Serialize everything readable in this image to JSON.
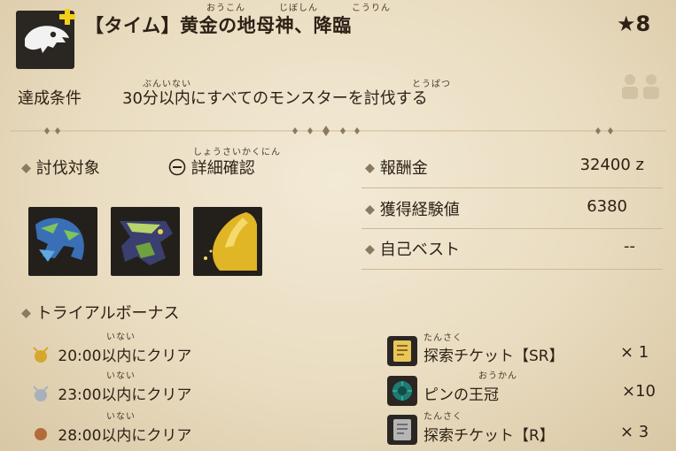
{
  "quest": {
    "title": "【タイム】黄金の地母神、降臨",
    "title_ruby": [
      "おうこん",
      "じぼしん",
      "こうりん"
    ],
    "rank": "★8",
    "condition_label": "達成条件",
    "condition_text": "30分以内にすべてのモンスターを討伐する",
    "condition_ruby": [
      "ぶんいない",
      "とうばつ"
    ],
    "icons": [
      "dragon-skull-icon",
      "plus-icon",
      "two-player-icon"
    ]
  },
  "targets": {
    "label": "討伐対象",
    "details_label": "詳細確認",
    "details_ruby": "しょうさいかくにん",
    "monsters": [
      "blue-monster-icon",
      "green-monster-icon",
      "golden-monster-icon"
    ]
  },
  "stats": [
    {
      "label": "報酬金",
      "value": "32400 z"
    },
    {
      "label": "獲得経験値",
      "value": "6380"
    },
    {
      "label": "自己ベスト",
      "value": "--"
    }
  ],
  "trial_bonus": {
    "label": "トライアルボーナス",
    "ruby": "いない",
    "rows": [
      {
        "time": "20:00以内にクリア",
        "medal": "gold",
        "reward": "探索チケット【SR】",
        "reward_ruby": "たんさく",
        "qty": "× 1"
      },
      {
        "time": "23:00以内にクリア",
        "medal": "silver",
        "reward": "ピンの王冠",
        "reward_ruby": "おうかん",
        "qty": "×10"
      },
      {
        "time": "28:00以内にクリア",
        "medal": "bronze",
        "reward": "探索チケット【R】",
        "reward_ruby": "たんさく",
        "qty": "× 3"
      }
    ]
  },
  "colors": {
    "background": "#efe4cc",
    "text": "#2d2116",
    "gold": "#d6a72c",
    "silver": "#a7b1bd",
    "bronze": "#b36b3c"
  }
}
